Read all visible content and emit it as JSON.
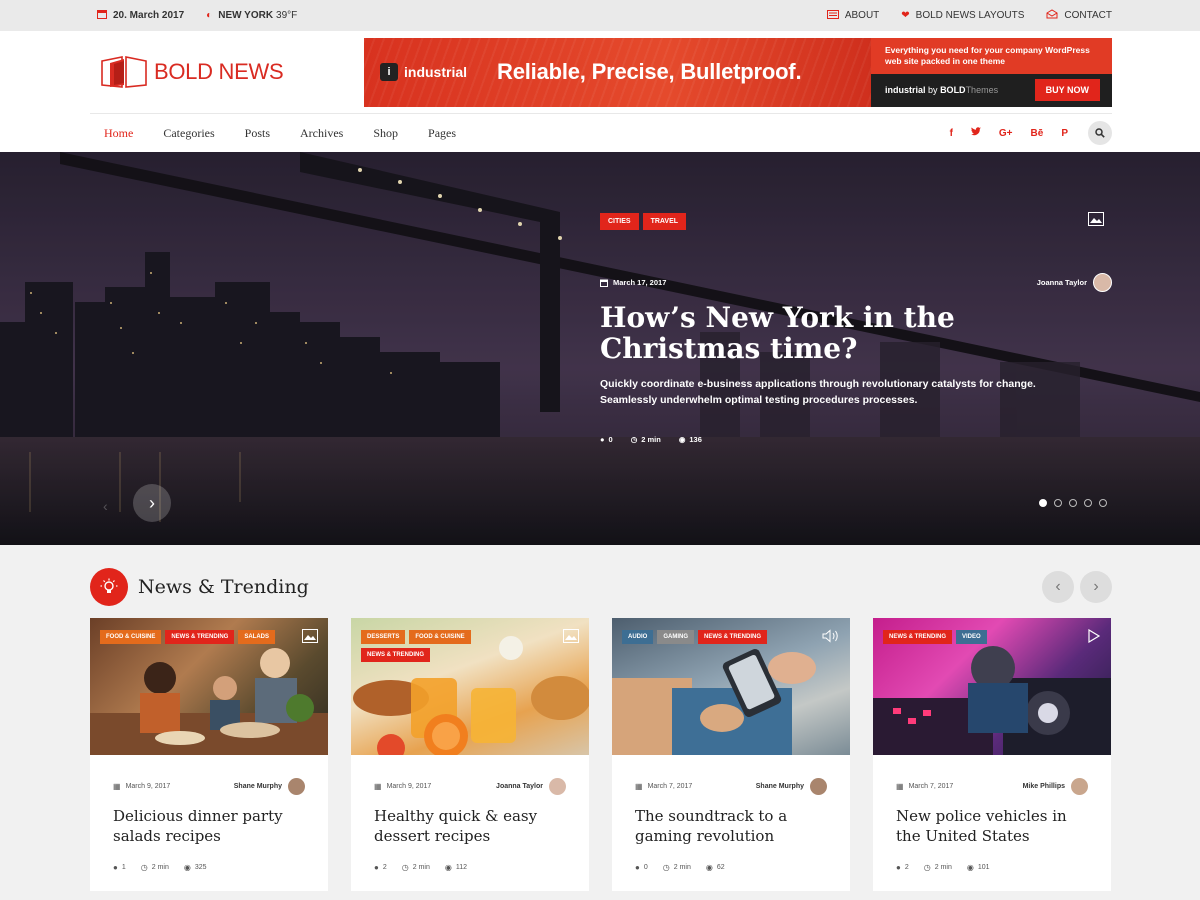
{
  "topbar": {
    "date": "20. March 2017",
    "city": "NEW YORK",
    "temp": "39°F",
    "links": [
      {
        "label": "ABOUT",
        "icon": "keyboard-icon"
      },
      {
        "label": "BOLD NEWS LAYOUTS",
        "icon": "heart-icon"
      },
      {
        "label": "CONTACT",
        "icon": "envelope-icon"
      }
    ]
  },
  "logo": {
    "text": "BOLD NEWS"
  },
  "banner": {
    "brand": "industrial",
    "headline": "Reliable, Precise, Bulletproof.",
    "tagline": "Everything you need for your company WordPress web site packed in one theme",
    "by_brand": "industrial",
    "by_word": "by",
    "by_company": "BOLD",
    "by_suffix": "Themes",
    "cta": "BUY NOW"
  },
  "nav": {
    "items": [
      "Home",
      "Categories",
      "Posts",
      "Archives",
      "Shop",
      "Pages"
    ],
    "social": [
      "f",
      "t",
      "G+",
      "Bē",
      "P"
    ]
  },
  "hero": {
    "tags": [
      "CITIES",
      "TRAVEL"
    ],
    "date": "March 17, 2017",
    "author": "Joanna Taylor",
    "title": "How’s New York in the Christmas time?",
    "description": "Quickly coordinate e-business applications through revolutionary catalysts for change. Seamlessly underwhelm optimal testing procedures processes.",
    "comments": "0",
    "read_time": "2 min",
    "views": "136",
    "slides_total": 5,
    "active_slide": 1
  },
  "section": {
    "title": "News & Trending"
  },
  "cards": [
    {
      "tags": [
        "FOOD & CUISINE",
        "NEWS & TRENDING",
        "SALADS"
      ],
      "date": "March 9, 2017",
      "author": "Shane Murphy",
      "title": "Delicious dinner party salads recipes",
      "comments": "1",
      "read_time": "2 min",
      "views": "325",
      "type_icon": "image-icon"
    },
    {
      "tags": [
        "DESSERTS",
        "FOOD & CUISINE",
        "NEWS & TRENDING"
      ],
      "date": "March 9, 2017",
      "author": "Joanna Taylor",
      "title": "Healthy quick & easy dessert recipes",
      "comments": "2",
      "read_time": "2 min",
      "views": "112",
      "type_icon": "image-icon"
    },
    {
      "tags": [
        "AUDIO",
        "GAMING",
        "NEWS & TRENDING"
      ],
      "date": "March 7, 2017",
      "author": "Shane Murphy",
      "title": "The soundtrack to a gaming revolution",
      "comments": "0",
      "read_time": "2 min",
      "views": "62",
      "type_icon": "speaker-icon"
    },
    {
      "tags": [
        "NEWS & TRENDING",
        "VIDEO"
      ],
      "date": "March 7, 2017",
      "author": "Mike Phillips",
      "title": "New police vehicles in the United States",
      "comments": "2",
      "read_time": "2 min",
      "views": "101",
      "type_icon": "play-icon"
    }
  ],
  "colors": {
    "accent": "#e1251b",
    "orange": "#e46b1c",
    "blue": "#3d6e93"
  }
}
